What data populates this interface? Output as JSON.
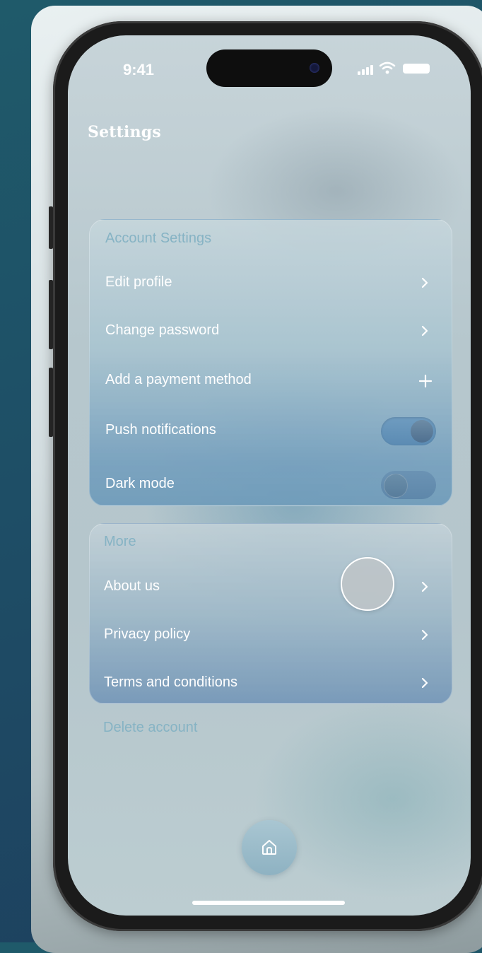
{
  "status_bar": {
    "time": "9:41",
    "icons": [
      "signal-icon",
      "wifi-icon",
      "battery-icon"
    ]
  },
  "page": {
    "title": "Settings"
  },
  "account_settings": {
    "heading": "Account Settings",
    "items": [
      {
        "label": "Edit profile",
        "control": "chevron-icon"
      },
      {
        "label": "Change password",
        "control": "chevron-icon"
      },
      {
        "label": "Add a payment method",
        "control": "plus-icon"
      },
      {
        "label": "Push notifications",
        "control": "toggle",
        "state": "on"
      },
      {
        "label": "Dark mode",
        "control": "toggle",
        "state": "off"
      }
    ]
  },
  "more": {
    "heading": "More",
    "items": [
      {
        "label": "About us",
        "control": "chevron-icon"
      },
      {
        "label": "Privacy policy",
        "control": "chevron-icon"
      },
      {
        "label": "Terms and conditions",
        "control": "chevron-icon"
      }
    ]
  },
  "footer": {
    "delete_label": "Delete account",
    "home_icon": "home-icon"
  },
  "colors": {
    "accent_text": "#86b3c4",
    "label_text": "#ffffff",
    "background": "#1e4e66"
  }
}
